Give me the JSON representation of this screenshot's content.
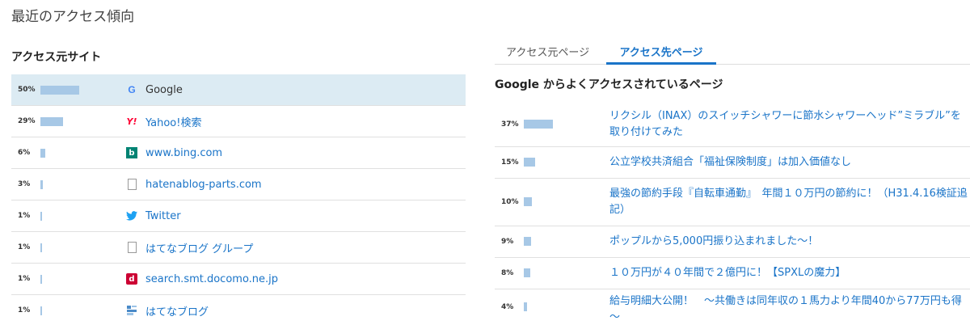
{
  "page_title": "最近のアクセス傾向",
  "left": {
    "heading": "アクセス元サイト",
    "rows": [
      {
        "pct": "50%",
        "value": 50,
        "label": "Google",
        "icon": "google-icon"
      },
      {
        "pct": "29%",
        "value": 29,
        "label": "Yahoo!検索",
        "icon": "yahoo-icon"
      },
      {
        "pct": "6%",
        "value": 6,
        "label": "www.bing.com",
        "icon": "bing-icon"
      },
      {
        "pct": "3%",
        "value": 3,
        "label": "hatenablog-parts.com",
        "icon": "document-icon"
      },
      {
        "pct": "1%",
        "value": 1,
        "label": "Twitter",
        "icon": "twitter-icon"
      },
      {
        "pct": "1%",
        "value": 1,
        "label": "はてなブログ グループ",
        "icon": "document-icon"
      },
      {
        "pct": "1%",
        "value": 1,
        "label": "search.smt.docomo.ne.jp",
        "icon": "docomo-icon"
      },
      {
        "pct": "1%",
        "value": 1,
        "label": "はてなブログ",
        "icon": "hatena-blog-icon"
      }
    ]
  },
  "right": {
    "tabs": [
      "アクセス元ページ",
      "アクセス先ページ"
    ],
    "heading": "Google からよくアクセスされているページ",
    "rows": [
      {
        "pct": "37%",
        "value": 37,
        "label": "リクシル（INAX）のスイッチシャワーに節水シャワーヘッド”ミラブル”を取り付けてみた"
      },
      {
        "pct": "15%",
        "value": 15,
        "label": "公立学校共済組合「福祉保険制度」は加入価値なし"
      },
      {
        "pct": "10%",
        "value": 10,
        "label": "最強の節約手段『自転車通勤』　年間１０万円の節約に！（H31.4.16検証追記）"
      },
      {
        "pct": "9%",
        "value": 9,
        "label": "ポップルから5,000円振り込まれました～！"
      },
      {
        "pct": "8%",
        "value": 8,
        "label": "１０万円が４０年間で２億円に！【SPXLの魔力】"
      },
      {
        "pct": "4%",
        "value": 4,
        "label": "給与明細大公開！　～共働きは同年収の１馬力より年間40から77万円も得～"
      }
    ]
  },
  "colors": {
    "link": "#1a74c8",
    "bar": "#a7c8e6",
    "selected_row": "#dcebf3"
  }
}
